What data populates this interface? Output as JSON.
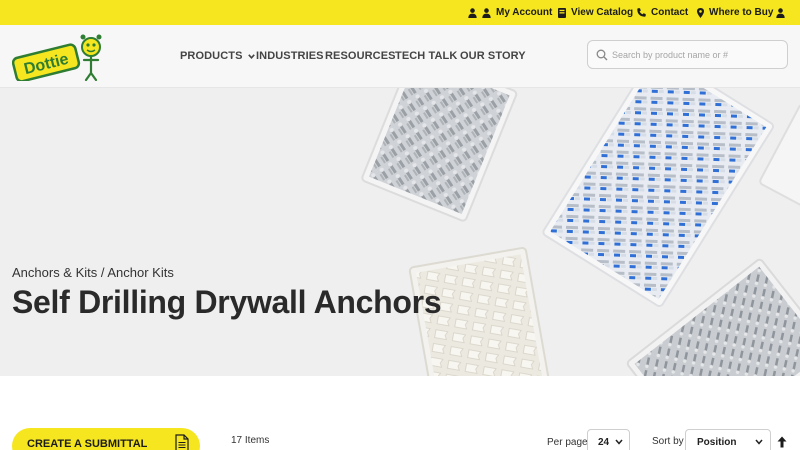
{
  "topbar": {
    "my_account": "My Account",
    "view_catalog": "View Catalog",
    "contact": "Contact",
    "where_to_buy": "Where to Buy"
  },
  "logo": {
    "text": "Dottie"
  },
  "nav": {
    "products": "PRODUCTS",
    "industries": "INDUSTRIES",
    "resources": "RESOURCES",
    "tech_talk": "TECH TALK",
    "our_story": "OUR STORY"
  },
  "search": {
    "placeholder": "Search by product name or #"
  },
  "hero": {
    "breadcrumb": "Anchors & Kits / Anchor Kits",
    "title": "Self Drilling Drywall Anchors"
  },
  "toolbar": {
    "submittal": "CREATE A SUBMITTAL",
    "items_count": "17 Items",
    "per_page_label": "Per page",
    "per_page_value": "24",
    "sort_by_label": "Sort by",
    "sort_value": "Position"
  },
  "colors": {
    "brand_yellow": "#f5e620",
    "text_dark": "#2a2a2a",
    "logo_green": "#2e7d32"
  }
}
